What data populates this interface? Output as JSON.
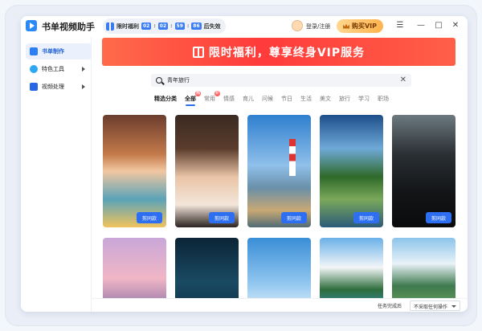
{
  "app": {
    "title": "书单视频助手"
  },
  "promo_timer": {
    "label": "限时福利",
    "hours": "02",
    "minutes": "02",
    "seconds": "59",
    "ms": "86",
    "suffix": "后失效"
  },
  "header": {
    "login_label": "登录/注册",
    "vip_label": "购买VIP"
  },
  "window_controls": {
    "menu": "☰",
    "minimize": "—",
    "maximize": "□",
    "close": "✕"
  },
  "sidebar": {
    "items": [
      {
        "label": "书单制作",
        "active": true
      },
      {
        "label": "特色工具",
        "active": false
      },
      {
        "label": "视频处理",
        "active": false
      }
    ]
  },
  "banner": {
    "text": "限时福利，尊享终身VIP服务"
  },
  "search": {
    "value": "青年旅行"
  },
  "categories": {
    "heading": "精选分类",
    "items": [
      {
        "label": "全部",
        "active": true,
        "badge": "热"
      },
      {
        "label": "常用",
        "active": false,
        "badge": "新"
      },
      {
        "label": "情感",
        "active": false,
        "badge": ""
      },
      {
        "label": "育儿",
        "active": false,
        "badge": ""
      },
      {
        "label": "问候",
        "active": false,
        "badge": ""
      },
      {
        "label": "节日",
        "active": false,
        "badge": ""
      },
      {
        "label": "生活",
        "active": false,
        "badge": ""
      },
      {
        "label": "美文",
        "active": false,
        "badge": ""
      },
      {
        "label": "旅行",
        "active": false,
        "badge": ""
      },
      {
        "label": "学习",
        "active": false,
        "badge": ""
      },
      {
        "label": "职场",
        "active": false,
        "badge": ""
      }
    ]
  },
  "cards": [
    {
      "button": "剪同款",
      "subject": "girl-costume"
    },
    {
      "button": "剪同款",
      "subject": "woman-portrait"
    },
    {
      "button": "剪同款",
      "subject": "lighthouse"
    },
    {
      "button": "剪同款",
      "subject": "forest-lake"
    },
    {
      "button": "剪同款",
      "subject": "athlete-back"
    }
  ],
  "bottom": {
    "label": "任务完成后",
    "select_value": "不采取任何操作"
  },
  "colors": {
    "accent": "#2e6ff2",
    "banner": "#ff3b3b",
    "vip": "#ffb34d"
  }
}
